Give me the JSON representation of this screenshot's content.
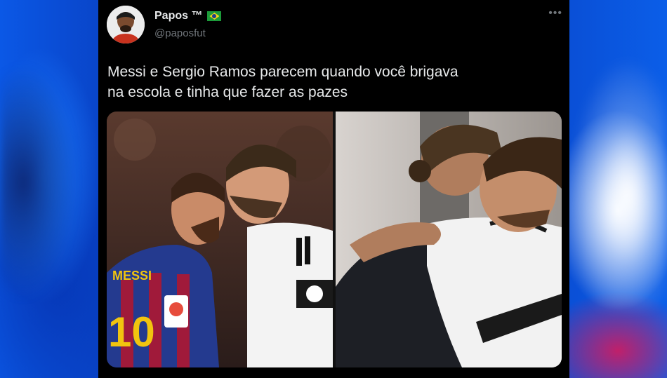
{
  "tweet": {
    "author_name": "Papos ™",
    "flag_icon": "brazil-flag-icon",
    "author_handle": "@paposfut",
    "more_icon": "more-options-icon",
    "text_line1": "Messi e Sergio Ramos parecem quando você brigava",
    "text_line2": "na escola e tinha que fazer as pazes"
  },
  "media": {
    "left_photo": "messi-ramos-headbutt-photo",
    "right_photo": "messi-ramos-hug-photo"
  },
  "colors": {
    "card_bg": "#000000",
    "text": "#e7e9ea",
    "muted": "#71767b",
    "page_bg": "#0a4fd6"
  }
}
